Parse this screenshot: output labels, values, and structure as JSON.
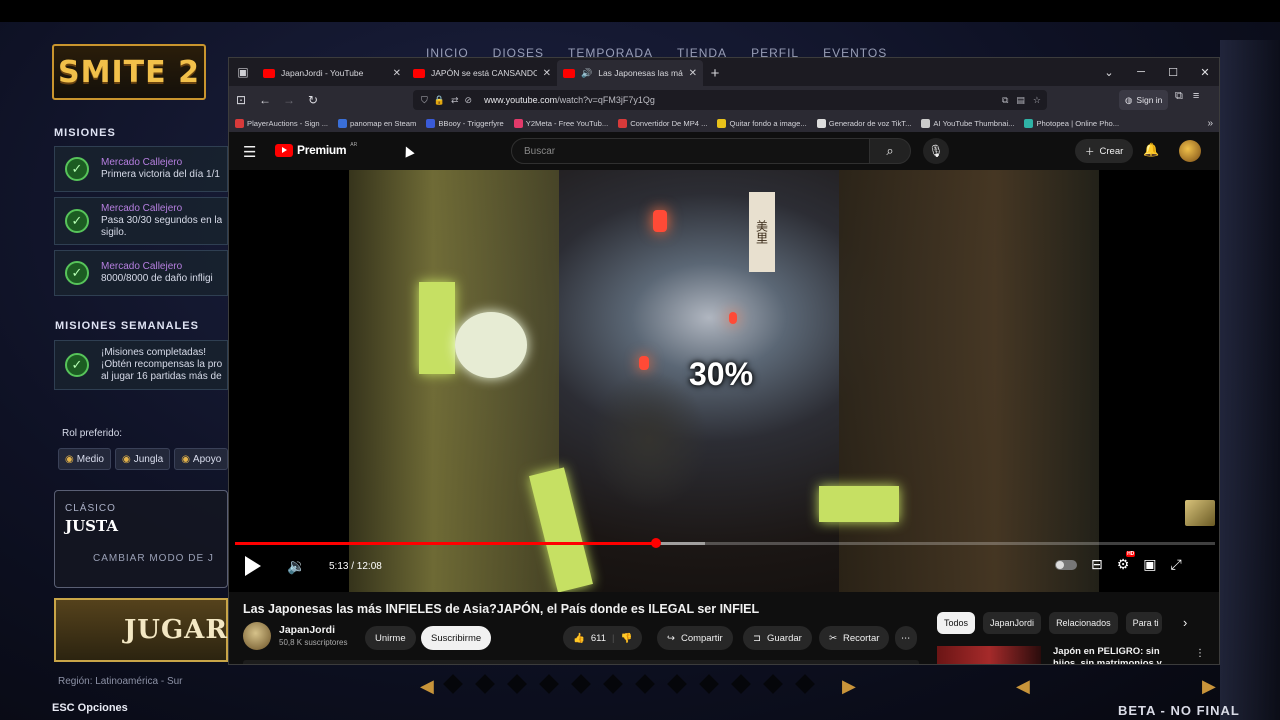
{
  "game": {
    "logo": "SMITE 2",
    "nav": [
      "INICIO",
      "DIOSES",
      "TEMPORADA",
      "TIENDA",
      "PERFIL",
      "EVENTOS"
    ],
    "missions_title": "MISIONES",
    "missions": [
      {
        "t1": "Mercado Callejero",
        "t2": "Primera victoria del día 1/1",
        "t3": ""
      },
      {
        "t1": "Mercado Callejero",
        "t2": "Pasa 30/30 segundos en la",
        "t3": "sigilo."
      },
      {
        "t1": "Mercado Callejero",
        "t2": "8000/8000 de daño infligi",
        "t3": ""
      }
    ],
    "weekly_title": "MISIONES SEMANALES",
    "weekly": {
      "t1": "¡Misiones completadas!",
      "t2": "¡Obtén recompensas la pro",
      "t3": "al jugar 16 partidas más de"
    },
    "rol_label": "Rol preferido:",
    "roles": [
      "Medio",
      "Jungla",
      "Apoyo"
    ],
    "mode_label": "CLÁSICO",
    "mode_name": "JUSTA",
    "mode_change": "CAMBIAR MODO DE J",
    "play": "JUGAR",
    "region": "Región: Latinoamérica - Sur",
    "esc": "ESC   Opciones",
    "beta": "BETA - NO FINAL"
  },
  "browser": {
    "tabs": [
      {
        "title": "JapanJordi - YouTube"
      },
      {
        "title": "JAPÓN se está CANSANDO de l"
      },
      {
        "title": "Las Japonesas las más INFIEL"
      }
    ],
    "url_host": "www.youtube.com",
    "url_path": "/watch?v=qFM3jF7y1Qg",
    "signin": "Sign in",
    "bookmarks": [
      {
        "label": "PlayerAuctions - Sign ...",
        "color": "#d83a3a"
      },
      {
        "label": "panomap en Steam",
        "color": "#3a6fd8"
      },
      {
        "label": "BBooy - Triggerfyre",
        "color": "#3a5bd8"
      },
      {
        "label": "Y2Meta - Free YouTub...",
        "color": "#e23a6a"
      },
      {
        "label": "Convertidor De MP4 ...",
        "color": "#d83a3a"
      },
      {
        "label": "Quitar fondo a image...",
        "color": "#e8c21a"
      },
      {
        "label": "Generador de voz TikT...",
        "color": "#dddddd"
      },
      {
        "label": "AI YouTube Thumbnai...",
        "color": "#cccccc"
      },
      {
        "label": "Photopea | Online Pho...",
        "color": "#2fb3a6"
      }
    ]
  },
  "youtube": {
    "logo": "Premium",
    "logo_region": "AR",
    "search_placeholder": "Buscar",
    "create": "Crear",
    "overlay_text": "30%",
    "sign_text": "美里",
    "time": "5:13 / 12:08",
    "progress": 0.43,
    "buffered": 0.48,
    "video_title": "Las Japonesas las más INFIELES de Asia?JAPÓN, el País donde es ILEGAL ser INFIEL",
    "channel": "JapanJordi",
    "subscribers": "50,8 K suscriptores",
    "join": "Unirme",
    "subscribe": "Suscribirme",
    "likes": "611",
    "share": "Compartir",
    "save": "Guardar",
    "clip": "Recortar",
    "chips": [
      "Todos",
      "JapanJordi",
      "Relacionados",
      "Para ti"
    ],
    "related_title": "Japón en PELIGRO: sin hijos, sin matrimonios y sin"
  }
}
